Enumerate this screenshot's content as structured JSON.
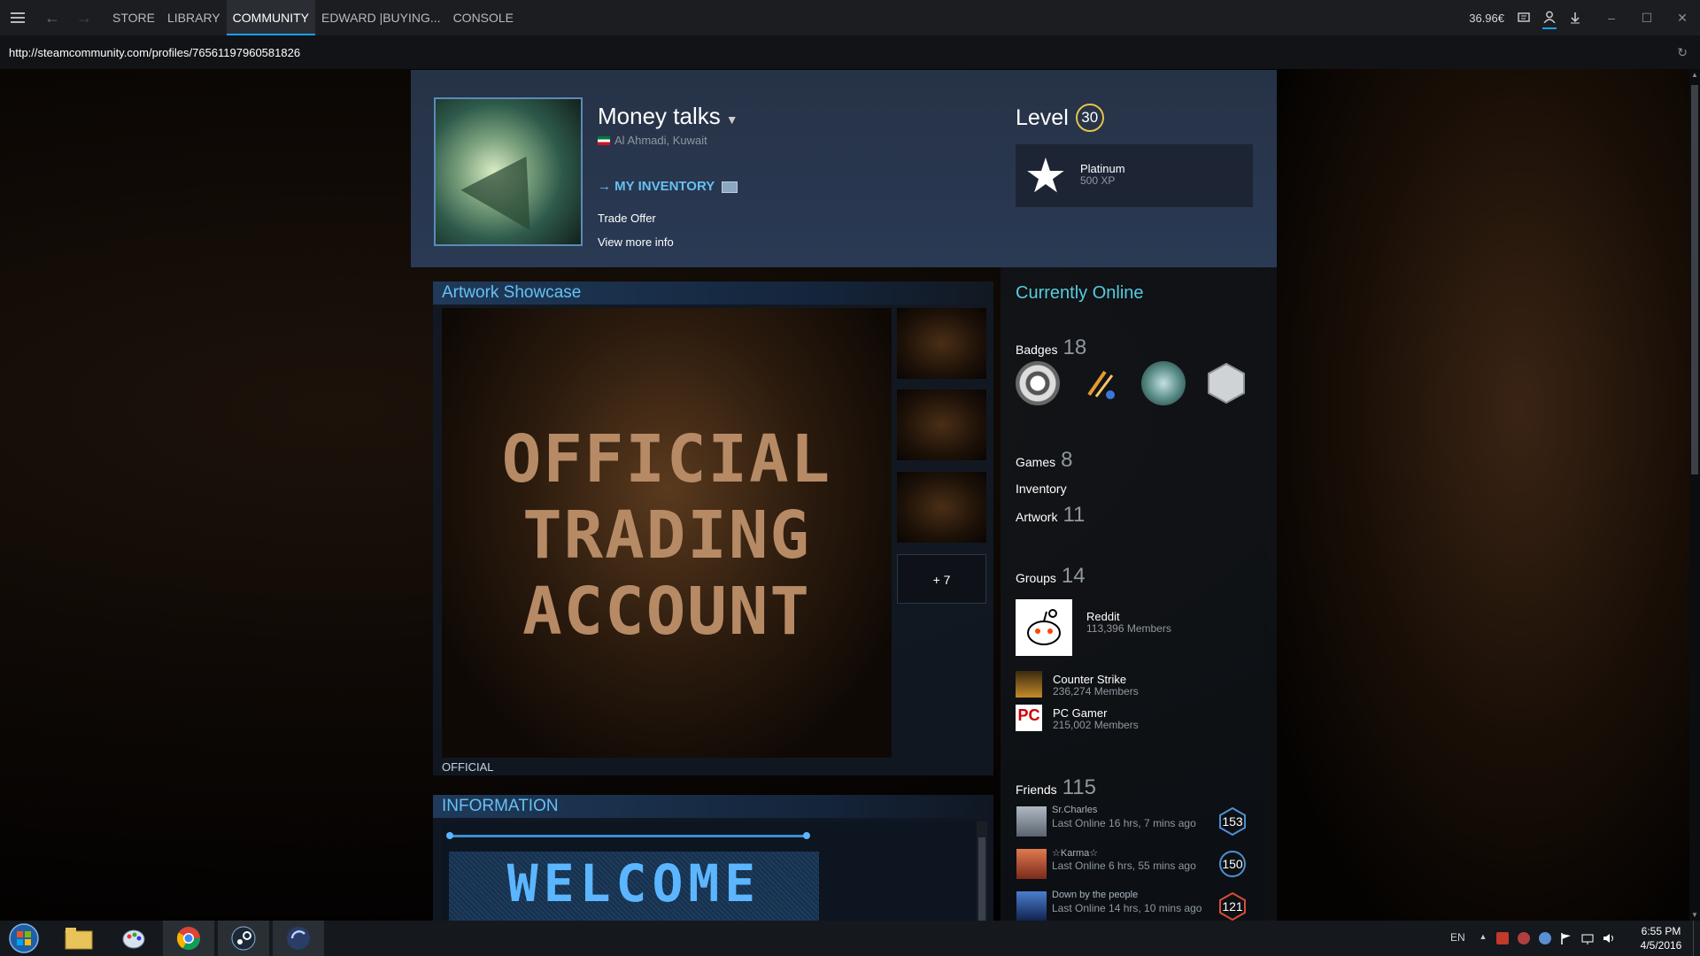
{
  "nav": {
    "tabs": [
      {
        "label": "STORE"
      },
      {
        "label": "LIBRARY"
      },
      {
        "label": "COMMUNITY"
      },
      {
        "label": "EDWARD |BUYING..."
      },
      {
        "label": "CONSOLE"
      }
    ],
    "wallet": "36.96€"
  },
  "url": "http://steamcommunity.com/profiles/76561197960581826",
  "profile": {
    "name": "Money talks",
    "location": "Al Ahmadi, Kuwait",
    "inventory_link": "→ MY INVENTORY",
    "trade_offer": "Trade Offer",
    "view_more": "View more info",
    "level_label": "Level",
    "level": "30",
    "badge_name": "Platinum",
    "badge_xp": "500 XP"
  },
  "artwork": {
    "title": "Artwork Showcase",
    "main_text_lines": [
      "OFFICIAL",
      "TRADING",
      "ACCOUNT"
    ],
    "more": "+ 7",
    "caption": "OFFICIAL"
  },
  "information": {
    "title": "INFORMATION",
    "welcome": "WELCOME"
  },
  "sidebar": {
    "status": "Currently Online",
    "badges_label": "Badges",
    "badges_count": "18",
    "games_label": "Games",
    "games_count": "8",
    "inventory_label": "Inventory",
    "artwork_label": "Artwork",
    "artwork_count": "11",
    "groups_label": "Groups",
    "groups_count": "14",
    "groups": [
      {
        "name": "Reddit",
        "members": "113,396 Members"
      },
      {
        "name": "Counter Strike",
        "members": "236,274 Members"
      },
      {
        "name": "PC Gamer",
        "members": "215,002 Members"
      }
    ],
    "friends_label": "Friends",
    "friends_count": "115",
    "friends": [
      {
        "name": "Sr.Charles",
        "status": "Last Online 16 hrs, 7 mins ago",
        "level": "153"
      },
      {
        "name": "☆Karma☆",
        "status": "Last Online 6 hrs, 55 mins ago",
        "level": "150"
      },
      {
        "name": "Down by the people",
        "status": "Last Online 14 hrs, 10 mins ago",
        "level": "121"
      }
    ]
  },
  "taskbar": {
    "lang": "EN",
    "time": "6:55 PM",
    "date": "4/5/2016"
  },
  "colors": {
    "accent": "#1a9fff",
    "link": "#66c0f4",
    "online": "#57cbde",
    "level_ring": "#e7c14a"
  }
}
